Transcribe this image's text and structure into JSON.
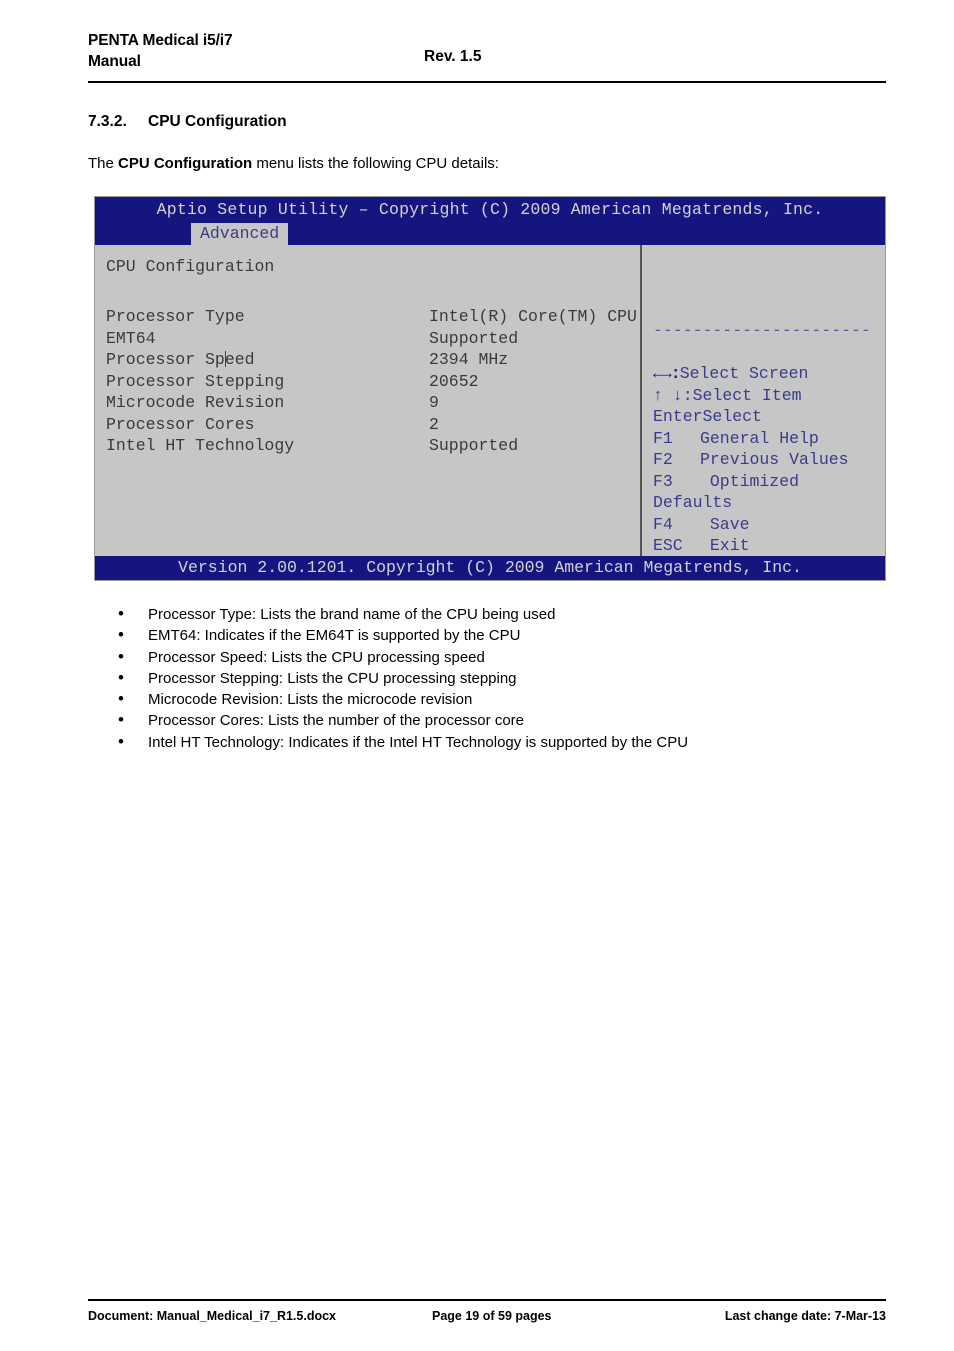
{
  "header": {
    "title_line1": "PENTA Medical i5/i7",
    "title_line2": "Manual",
    "revision": "Rev. 1.5"
  },
  "section": {
    "number": "7.3.2.",
    "title": "CPU Configuration",
    "intro_prefix": "The ",
    "intro_bold": "CPU Configuration",
    "intro_suffix": " menu lists the following CPU details:"
  },
  "bios": {
    "title": "Aptio Setup Utility – Copyright (C) 2009 American Megatrends, Inc.",
    "tab_label": "Advanced",
    "panel_title": "CPU Configuration",
    "rows": [
      {
        "label": "Processor Type",
        "value": "Intel(R) Core(TM) CPU"
      },
      {
        "label": "EMT64",
        "value": "Supported"
      },
      {
        "label": "Processor Speed",
        "value": "2394 MHz"
      },
      {
        "label": "Processor Stepping",
        "value": "20652"
      },
      {
        "label": "Microcode Revision",
        "value": "9"
      },
      {
        "label": "Processor Cores",
        "value": "2"
      },
      {
        "label": "Intel HT Technology",
        "value": "Supported"
      }
    ],
    "help": {
      "separator": "----------------------",
      "lines": [
        {
          "key": "←→:",
          "desc": "Select Screen"
        },
        {
          "key": "↑ ↓:",
          "desc": "Select Item"
        },
        {
          "key": "Enter",
          "desc": "Select"
        },
        {
          "key": "F1",
          "desc": "General Help"
        },
        {
          "key": "F2",
          "desc": "Previous Values"
        },
        {
          "key": "F3",
          "desc": " Optimized"
        },
        {
          "key": "Defaults",
          "desc": ""
        },
        {
          "key": "F4",
          "desc": " Save"
        },
        {
          "key": "ESC",
          "desc": " Exit"
        }
      ]
    },
    "version_bar": "Version 2.00.1201. Copyright (C) 2009 American Megatrends, Inc.",
    "colors": {
      "navy": "#151580",
      "panel_gray": "#c6c6c6",
      "help_blue": "#3b3b8c",
      "text_gray": "#3a3a3a"
    }
  },
  "bullets": [
    "Processor Type: Lists the brand name of the CPU being used",
    "EMT64: Indicates if the EM64T is supported by the CPU",
    "Processor Speed: Lists the CPU processing speed",
    "Processor Stepping: Lists the CPU processing stepping",
    "Microcode Revision: Lists the microcode revision",
    "Processor Cores: Lists the number of the processor core",
    "Intel HT Technology: Indicates if the Intel HT Technology is supported by the CPU"
  ],
  "bullet_glyph": "•",
  "footer": {
    "document": "Document: Manual_Medical_i7_R1.5.docx",
    "page": "Page 19 of 59 pages",
    "last_change": "Last change date: 7-Mar-13"
  }
}
